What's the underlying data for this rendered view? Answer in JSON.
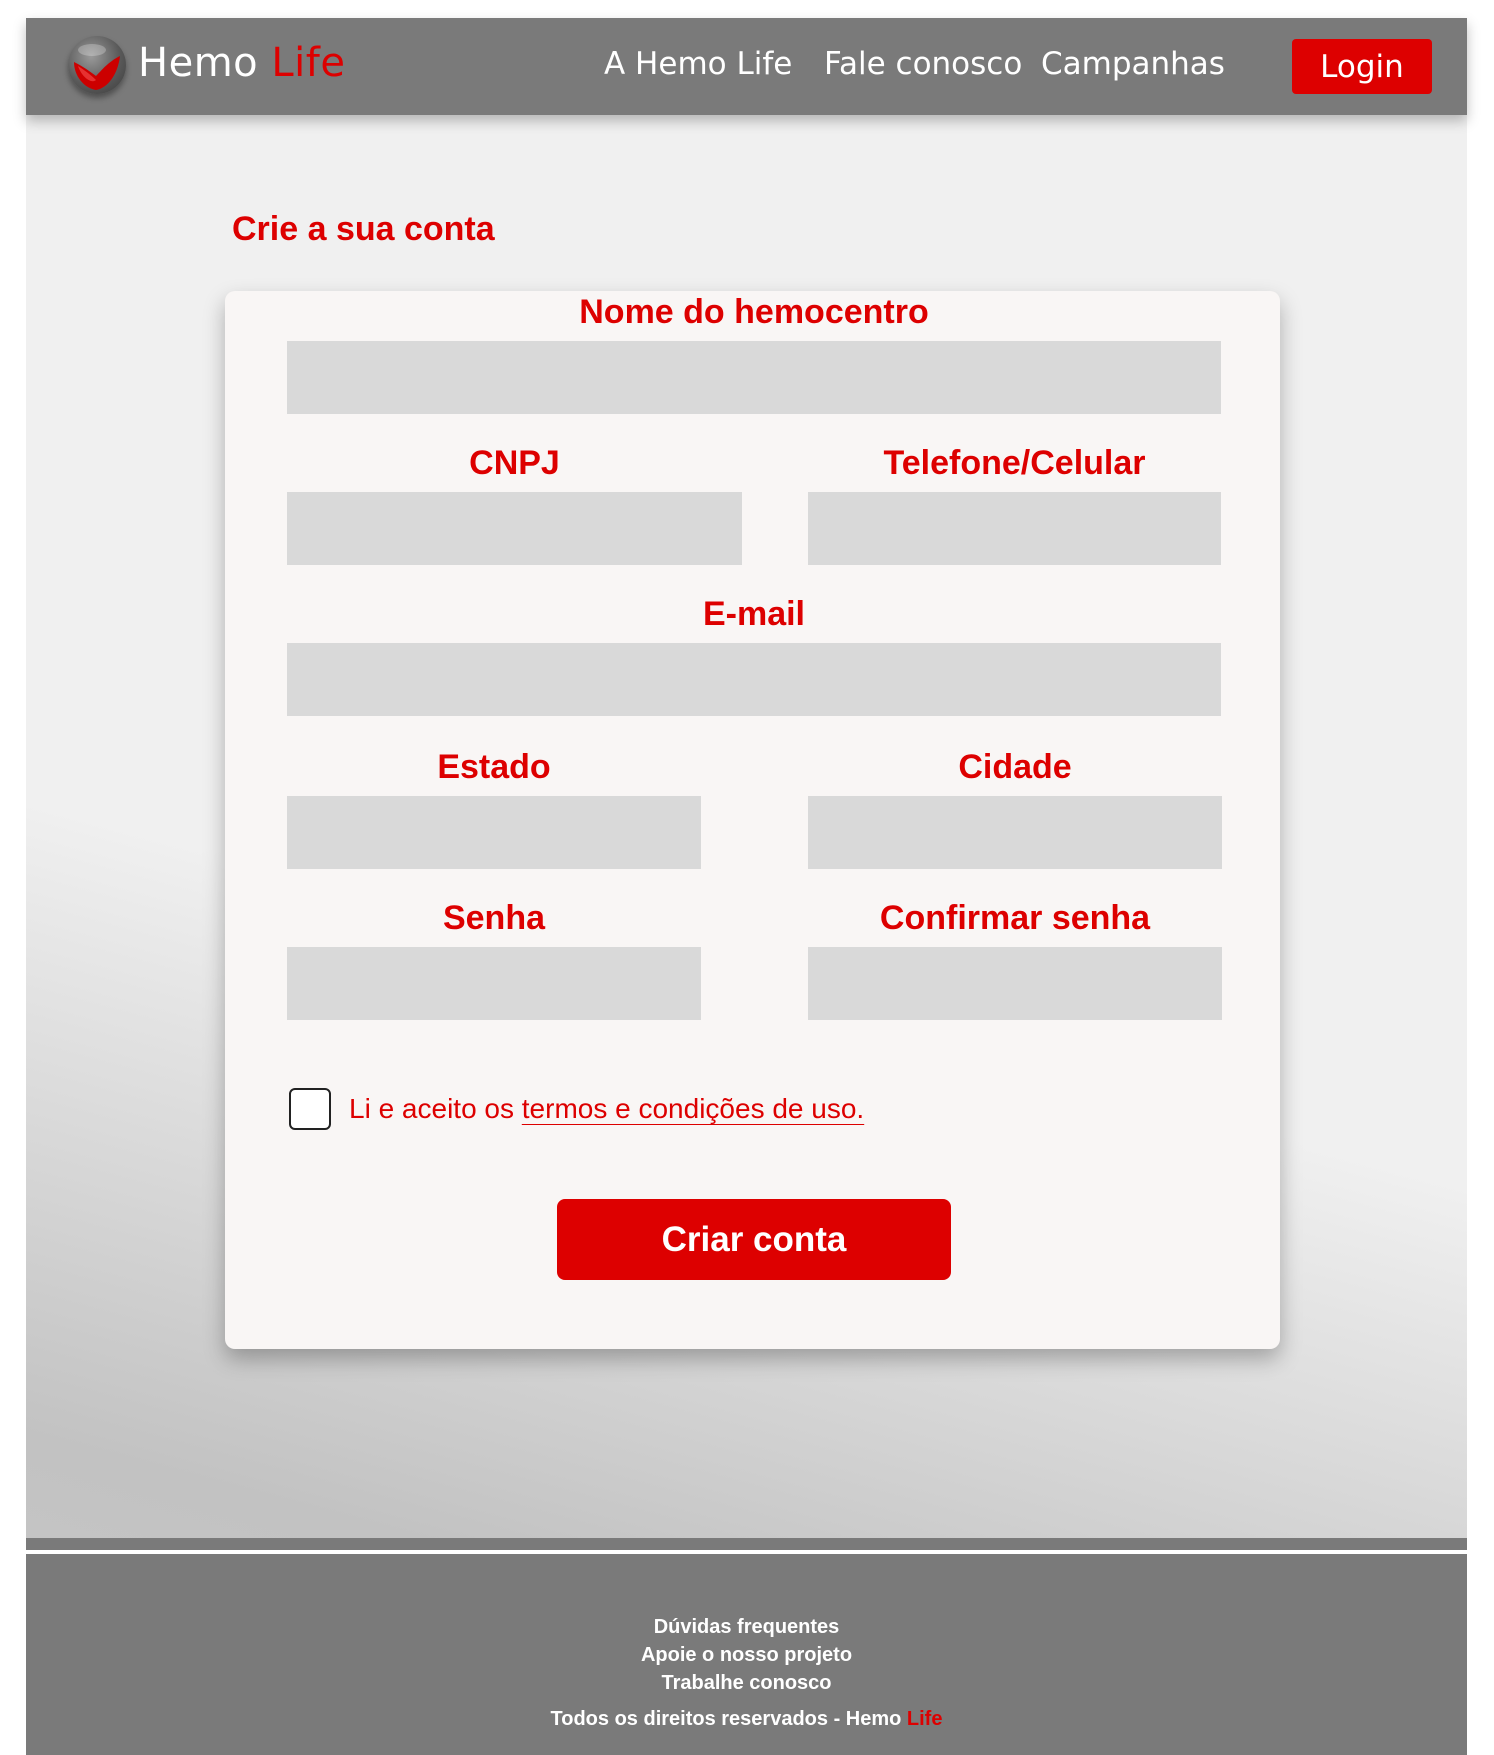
{
  "header": {
    "brand_main": "Hemo ",
    "brand_accent": "Life",
    "logo_icon": "blood-drop-globe-icon",
    "nav": [
      {
        "label": "A Hemo Life"
      },
      {
        "label": "Fale conosco"
      },
      {
        "label": "Campanhas"
      }
    ],
    "login_label": "Login"
  },
  "page": {
    "title": "Crie a sua conta"
  },
  "form": {
    "fields": {
      "nome": {
        "label": "Nome do hemocentro",
        "value": ""
      },
      "cnpj": {
        "label": "CNPJ",
        "value": ""
      },
      "telefone": {
        "label": "Telefone/Celular",
        "value": ""
      },
      "email": {
        "label": "E-mail",
        "value": ""
      },
      "estado": {
        "label": "Estado",
        "value": ""
      },
      "cidade": {
        "label": "Cidade",
        "value": ""
      },
      "senha": {
        "label": "Senha",
        "value": ""
      },
      "confirmar": {
        "label": "Confirmar senha",
        "value": ""
      }
    },
    "terms_prefix": "Li e aceito os ",
    "terms_link": "termos e condições de uso.",
    "terms_checked": false,
    "submit_label": "Criar conta"
  },
  "footer": {
    "links": [
      "Dúvidas frequentes",
      "Apoie o nosso projeto",
      "Trabalhe conosco"
    ],
    "copyright_main": "Todos os direitos reservados - Hemo ",
    "copyright_accent": "Life"
  },
  "colors": {
    "accent": "#dd0000",
    "header_bg": "#7a7a7a",
    "field_bg": "#d9d9d9",
    "card_bg": "#f9f6f5"
  }
}
